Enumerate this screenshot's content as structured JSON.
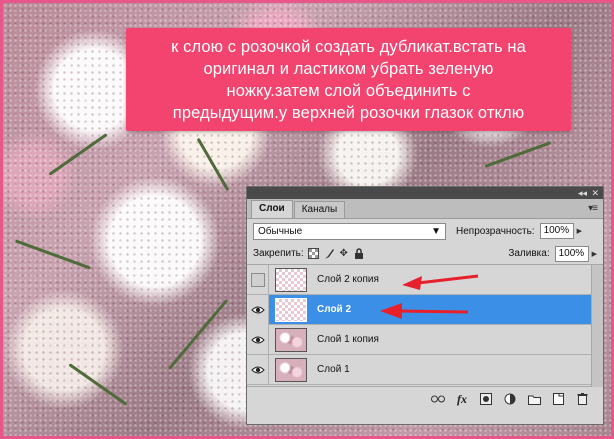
{
  "instruction": {
    "lines": [
      "к слою с розочкой создать дубликат.встать на",
      "оригинал и ластиком убрать зеленую",
      "ножку.затем слой объединить с",
      "предыдущим.у верхней  розочки  глазок отклю"
    ]
  },
  "panel": {
    "tabs": [
      "Слои",
      "Каналы"
    ],
    "blend_mode": "Обычные",
    "opacity_label": "Непрозрачность:",
    "opacity_value": "100%",
    "lock_label": "Закрепить:",
    "fill_label": "Заливка:",
    "fill_value": "100%",
    "layers": [
      {
        "name": "Слой 2 копия",
        "visible": false,
        "selected": false
      },
      {
        "name": "Слой 2",
        "visible": true,
        "selected": true
      },
      {
        "name": "Слой 1 копия",
        "visible": true,
        "selected": false
      },
      {
        "name": "Слой 1",
        "visible": true,
        "selected": false
      }
    ],
    "bottom_icons": [
      "link-icon",
      "fx-icon",
      "mask-icon",
      "adjustment-icon",
      "folder-icon",
      "new-layer-icon",
      "trash-icon"
    ]
  },
  "colors": {
    "banner": "#f2446f",
    "frame": "#e8578a",
    "selection": "#3c8fe6",
    "arrow": "#e8202a"
  }
}
